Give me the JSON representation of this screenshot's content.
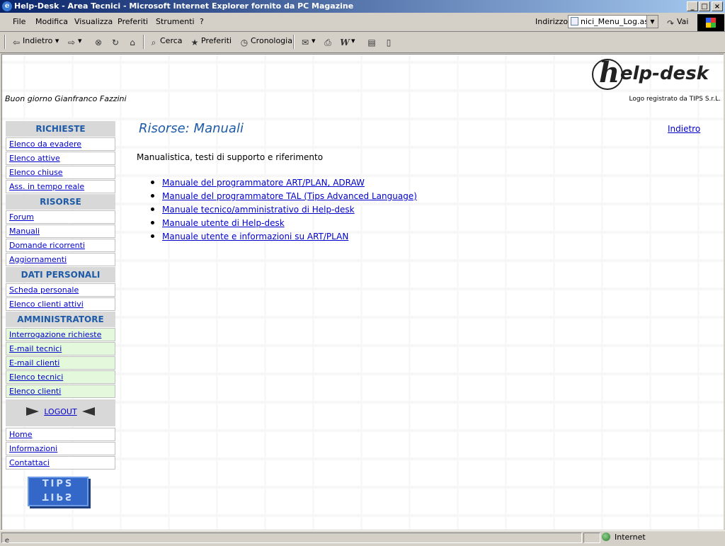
{
  "window": {
    "title": "Help-Desk - Area Tecnici - Microsoft Internet Explorer fornito da PC Magazine",
    "minimize": "_",
    "maximize": "□",
    "close": "×"
  },
  "menubar": {
    "items": [
      "File",
      "Modifica",
      "Visualizza",
      "Preferiti",
      "Strumenti",
      "?"
    ]
  },
  "address": {
    "label": "Indirizzo",
    "value": "nici_Menu_Log.asp",
    "go_label": "Vai"
  },
  "toolbar": {
    "back_label": "Indietro",
    "search_label": "Cerca",
    "favorites_label": "Preferiti",
    "history_label": "Cronologia"
  },
  "page": {
    "greeting": "Buon giorno Gianfranco Fazzini",
    "logo_text": "elp-desk",
    "logo_letter": "h",
    "logo_caption": "Logo registrato da TIPS S.r.L.",
    "title": "Risorse: Manuali",
    "back_link": "Indietro",
    "description": "Manualistica, testi di supporto e riferimento",
    "manual_links": [
      "Manuale del programmatore ART/PLAN, ADRAW",
      "Manuale del programmatore TAL (Tips Advanced Language)",
      "Manuale tecnico/amministrativo di Help-desk",
      "Manuale utente di Help-desk",
      "Manuale utente e informazioni su ART/PLAN"
    ]
  },
  "sidebar": {
    "richieste": {
      "header": "RICHIESTE",
      "items": [
        "Elenco da evadere",
        "Elenco attive",
        "Elenco chiuse",
        "Ass. in tempo reale"
      ]
    },
    "risorse": {
      "header": "RISORSE",
      "items": [
        "Forum",
        "Manuali",
        "Domande ricorrenti",
        "Aggiornamenti"
      ]
    },
    "dati_personali": {
      "header": "DATI PERSONALI",
      "items": [
        "Scheda personale",
        "Elenco clienti attivi"
      ]
    },
    "amministratore": {
      "header": "AMMINISTRATORE",
      "items": [
        "Interrogazione richieste",
        "E-mail tecnici",
        "E-mail clienti",
        "Elenco tecnici",
        "Elenco clienti"
      ]
    },
    "logout_label": "LOGOUT",
    "footer_items": [
      "Home",
      "Informazioni",
      "Contattaci"
    ],
    "tips_logo": "TIPS"
  },
  "statusbar": {
    "zone": "Internet"
  }
}
